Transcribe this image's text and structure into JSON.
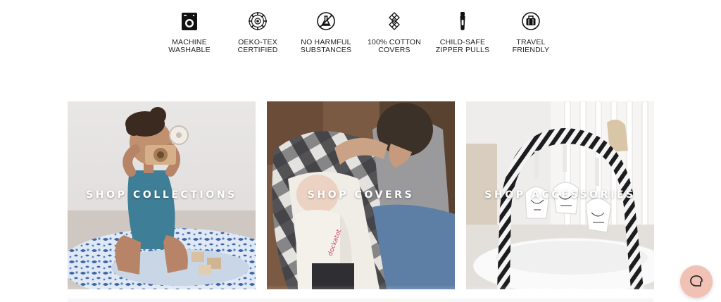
{
  "features": [
    {
      "icon": "washing-machine-icon",
      "line1": "MACHINE",
      "line2": "WASHABLE"
    },
    {
      "icon": "oeko-tex-badge-icon",
      "line1": "OEKO-TEX",
      "line2": "CERTIFIED"
    },
    {
      "icon": "no-chemicals-flask-icon",
      "line1": "NO HARMFUL",
      "line2": "SUBSTANCES"
    },
    {
      "icon": "cotton-weave-icon",
      "line1": "100% COTTON",
      "line2": "COVERS"
    },
    {
      "icon": "zipper-pull-icon",
      "line1": "CHILD-SAFE",
      "line2": "ZIPPER PULLS"
    },
    {
      "icon": "luggage-icon",
      "line1": "TRAVEL",
      "line2": "FRIENDLY"
    }
  ],
  "tiles": [
    {
      "label": "SHOP COLLECTIONS"
    },
    {
      "label": "SHOP COVERS"
    },
    {
      "label": "SHOP ACCESSORIES"
    }
  ],
  "help_button": {
    "icon": "chat-bubble-icon"
  },
  "colors": {
    "help_button_bg": "#f2c1b5",
    "caption_text": "#ffffff",
    "feature_text": "#222222"
  }
}
